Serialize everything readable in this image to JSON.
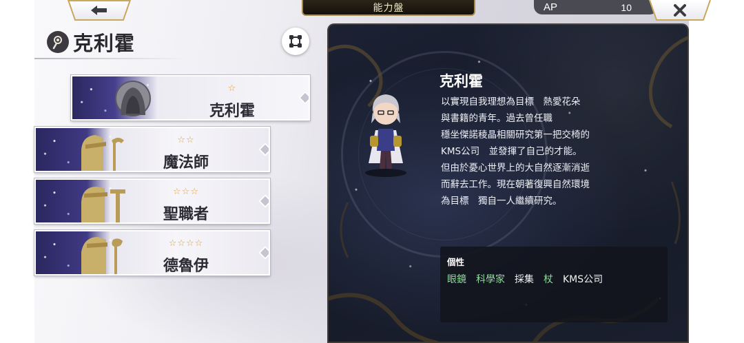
{
  "topbar": {
    "back_icon": "arrow-left-icon",
    "title": "能力盤",
    "ap_label": "AP",
    "ap_value": "10",
    "close_icon": "close-icon"
  },
  "header": {
    "character_name": "克利霍",
    "character_icon": "staff-emblem-icon",
    "expand_icon": "expand-nodes-icon"
  },
  "jobs": [
    {
      "label": "克利霍",
      "stars": "☆",
      "rank": 1,
      "portrait": "hooded-portrait"
    },
    {
      "label": "魔法師",
      "stars": "☆☆",
      "rank": 2,
      "portrait": "mage-silhouette"
    },
    {
      "label": "聖職者",
      "stars": "☆☆☆",
      "rank": 3,
      "portrait": "cleric-silhouette"
    },
    {
      "label": "德魯伊",
      "stars": "☆☆☆☆",
      "rank": 4,
      "portrait": "druid-silhouette"
    }
  ],
  "info": {
    "name": "克利霍",
    "description_lines": [
      "以實現自我理想為目標　熱愛花朵",
      "與書籍的青年。過去曾任職",
      "穩坐傑諾稜晶相關研究第一把交椅的",
      "KMS公司　並發揮了自己的才能。",
      "但由於憂心世界上的大自然逐漸消逝",
      "而辭去工作。現在朝著復興自然環境",
      "為目標　獨自一人繼續研究。"
    ],
    "traits_title": "個性",
    "traits": [
      {
        "label": "眼鏡",
        "color": "#8fd89a"
      },
      {
        "label": "科學家",
        "color": "#8fd89a"
      },
      {
        "label": "採集",
        "color": "#f2f2f2"
      },
      {
        "label": "杖",
        "color": "#8fd89a"
      },
      {
        "label": "KMS公司",
        "color": "#f2f2f2"
      }
    ]
  },
  "colors": {
    "star": "#e1a23a",
    "trait_highlight": "#8fd89a",
    "panel_bg": "#1a1f2e",
    "gold_trim": "#c9a85c"
  }
}
